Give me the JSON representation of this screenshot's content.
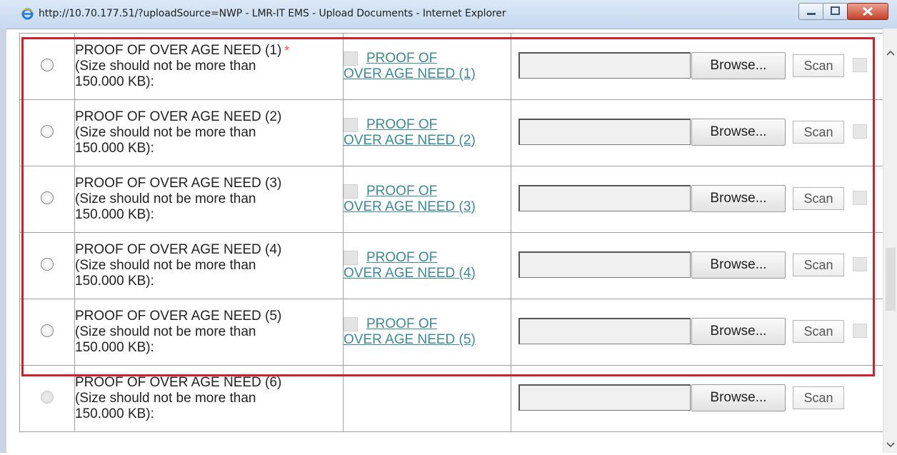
{
  "window": {
    "title": "http://10.70.177.51/?uploadSource=NWP - LMR-IT EMS - Upload Documents - Internet Explorer",
    "icon": "ie-icon",
    "controls": [
      "minimize",
      "maximize",
      "close"
    ]
  },
  "rows": [
    {
      "label": "PROOF OF OVER AGE NEED (1)",
      "required_mark": "*",
      "size_note": "(Size should not be more than",
      "size_value": "150.000 KB):",
      "link_line1": "PROOF OF",
      "link_line2": "OVER AGE NEED (1)",
      "browse": "Browse...",
      "scan": "Scan",
      "enabled": true
    },
    {
      "label": "PROOF OF OVER AGE NEED (2)",
      "required_mark": "",
      "size_note": "(Size should not be more than",
      "size_value": "150.000 KB):",
      "link_line1": "PROOF OF",
      "link_line2": "OVER AGE NEED (2)",
      "browse": "Browse...",
      "scan": "Scan",
      "enabled": true
    },
    {
      "label": "PROOF OF OVER AGE NEED (3)",
      "required_mark": "",
      "size_note": "(Size should not be more than",
      "size_value": "150.000 KB):",
      "link_line1": "PROOF OF",
      "link_line2": "OVER AGE NEED (3)",
      "browse": "Browse...",
      "scan": "Scan",
      "enabled": true
    },
    {
      "label": "PROOF OF OVER AGE NEED (4)",
      "required_mark": "",
      "size_note": "(Size should not be more than",
      "size_value": "150.000 KB):",
      "link_line1": "PROOF OF",
      "link_line2": "OVER AGE NEED (4)",
      "browse": "Browse...",
      "scan": "Scan",
      "enabled": true
    },
    {
      "label": "PROOF OF OVER AGE NEED (5)",
      "required_mark": "",
      "size_note": "(Size should not be more than",
      "size_value": "150.000 KB):",
      "link_line1": "PROOF OF",
      "link_line2": "OVER AGE NEED (5)",
      "browse": "Browse...",
      "scan": "Scan",
      "enabled": true
    },
    {
      "label": "PROOF OF OVER AGE NEED (6)",
      "required_mark": "",
      "size_note": "(Size should not be more than",
      "size_value": "150.000 KB):",
      "link_line1": "",
      "link_line2": "",
      "browse": "Browse...",
      "scan": "Scan",
      "enabled": false
    }
  ],
  "colors": {
    "highlight_border": "#d0202e",
    "link": "#3a8a98",
    "required": "#d9534f"
  }
}
